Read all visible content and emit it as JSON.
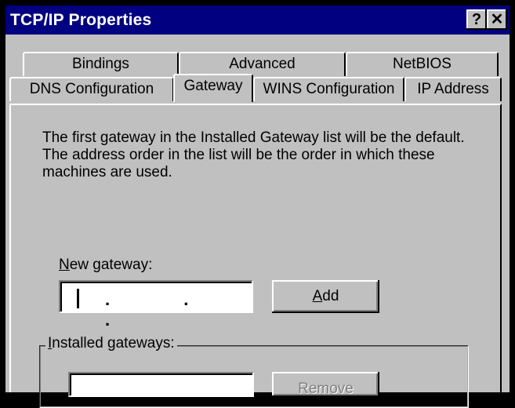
{
  "window": {
    "title": "TCP/IP Properties",
    "help_label": "?",
    "close_label": "✕"
  },
  "tabs": {
    "row1": [
      {
        "label": "Bindings"
      },
      {
        "label": "Advanced"
      },
      {
        "label": "NetBIOS"
      }
    ],
    "row2": [
      {
        "label": "DNS Configuration"
      },
      {
        "label": "Gateway",
        "active": true
      },
      {
        "label": "WINS Configuration"
      },
      {
        "label": "IP Address"
      }
    ]
  },
  "gateway_tab": {
    "description_line1": "The first gateway in the Installed Gateway list will be the default.",
    "description_line2": "The address order in the list will be the order in which these",
    "description_line3": "machines are used.",
    "new_gateway_label_first": "N",
    "new_gateway_label_rest": "ew gateway:",
    "new_gateway_value": ". . .",
    "add_first": "A",
    "add_rest": "dd",
    "installed_label_first": "I",
    "installed_label_rest": "nstalled gateways:",
    "remove_label": "Remove"
  }
}
